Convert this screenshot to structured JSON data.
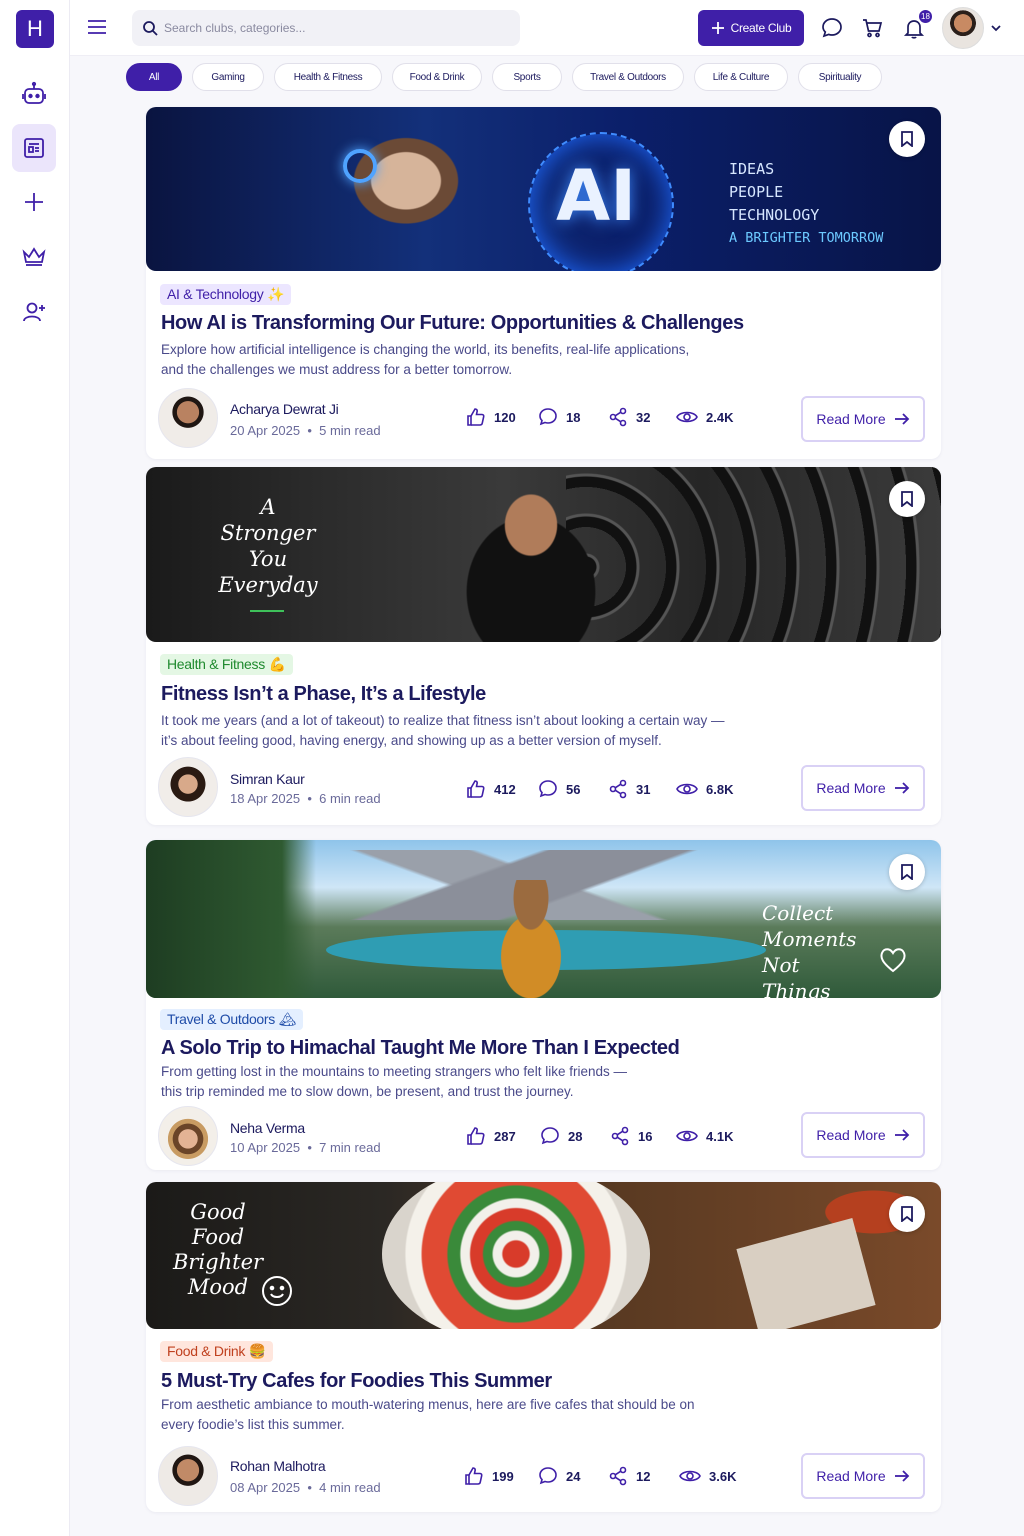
{
  "app": {
    "logo_letter": "H"
  },
  "search": {
    "placeholder": "Search clubs, categories..."
  },
  "header": {
    "create_label": "Create Club",
    "notification_count": "18"
  },
  "categories": [
    "All",
    "Gaming",
    "Health & Fitness",
    "Food & Drink",
    "Sports",
    "Travel & Outdoors",
    "Life & Culture",
    "Spirituality"
  ],
  "posts": [
    {
      "tag": "AI & Technology ✨",
      "title": "How AI is Transforming Our Future: Opportunities & Challenges",
      "desc1": "Explore how artificial intelligence is changing the world, its benefits, real-life applications,",
      "desc2": "and the challenges we must address for a better tomorrow.",
      "author": "Acharya Dewrat Ji",
      "date": "20 Apr 2025",
      "read_time": "5 min read",
      "likes": "120",
      "comments": "18",
      "shares": "32",
      "views": "2.4K",
      "read_more": "Read More",
      "banner_lines": [
        "AI",
        "IDEAS",
        "PEOPLE",
        "TECHNOLOGY",
        "A BRIGHTER TOMORROW"
      ]
    },
    {
      "tag": "Health & Fitness 💪",
      "title": "Fitness Isn’t a Phase, It’s a Lifestyle",
      "desc1": "It took me years (and a lot of takeout) to realize that fitness isn’t about looking a certain way —",
      "desc2": "it’s about feeling good, having energy, and showing up as a better version of myself.",
      "author": "Simran Kaur",
      "date": "18 Apr 2025",
      "read_time": "6 min read",
      "likes": "412",
      "comments": "56",
      "shares": "31",
      "views": "6.8K",
      "read_more": "Read More",
      "banner_lines": [
        "A",
        "Stronger",
        "You",
        "Everyday"
      ]
    },
    {
      "tag": "Travel & Outdoors 🏔",
      "title": "A Solo Trip to Himachal Taught Me More Than I Expected",
      "desc1": "From getting lost in the mountains to meeting strangers who felt like friends —",
      "desc2": "this trip reminded me to slow down, be present, and trust the journey.",
      "author": "Neha Verma",
      "date": "10 Apr 2025",
      "read_time": "7 min read",
      "likes": "287",
      "comments": "28",
      "shares": "16",
      "views": "4.1K",
      "read_more": "Read More",
      "banner_lines": [
        "Collect",
        "Moments",
        "Not Things"
      ]
    },
    {
      "tag": "Food & Drink 🍔",
      "title": "5 Must-Try Cafes for Foodies This Summer",
      "desc1": "From aesthetic ambiance to mouth-watering menus, here are five cafes that should be on",
      "desc2": "every foodie’s list this summer.",
      "author": "Rohan Malhotra",
      "date": "08 Apr 2025",
      "read_time": "4 min read",
      "likes": "199",
      "comments": "24",
      "shares": "12",
      "views": "3.6K",
      "read_more": "Read More",
      "banner_lines": [
        "Good",
        "Food",
        "Brighter",
        "Mood"
      ]
    }
  ],
  "colors": {
    "brand": "#3f1fa8",
    "pill_active": "#3f1fa8"
  }
}
